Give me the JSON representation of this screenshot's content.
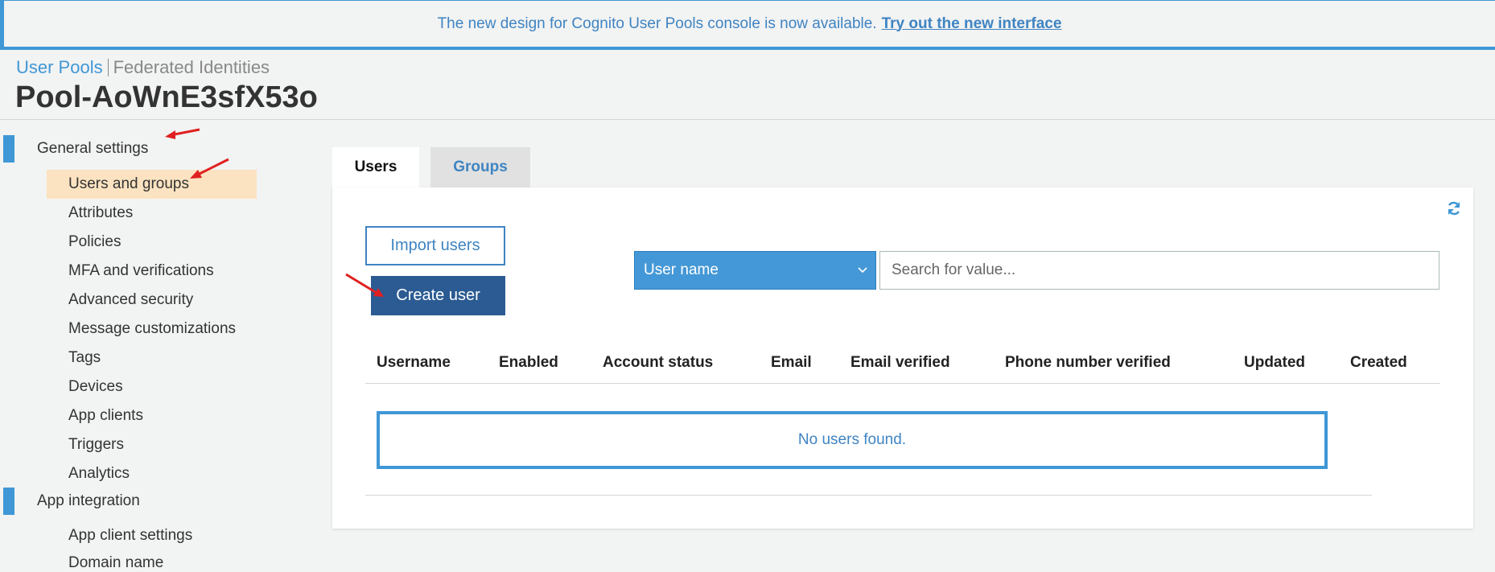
{
  "banner": {
    "text": "The new design for Cognito User Pools console is now available.",
    "link": "Try out the new interface"
  },
  "header": {
    "crumb_active": "User Pools",
    "crumb_inactive": "Federated Identities",
    "title": "Pool-AoWnE3sfX53o"
  },
  "sidebar": {
    "sections": [
      {
        "label": "General settings"
      },
      {
        "label": "App integration"
      }
    ],
    "items": [
      {
        "label": "Users and groups"
      },
      {
        "label": "Attributes"
      },
      {
        "label": "Policies"
      },
      {
        "label": "MFA and verifications"
      },
      {
        "label": "Advanced security"
      },
      {
        "label": "Message customizations"
      },
      {
        "label": "Tags"
      },
      {
        "label": "Devices"
      },
      {
        "label": "App clients"
      },
      {
        "label": "Triggers"
      },
      {
        "label": "Analytics"
      },
      {
        "label": "App client settings"
      },
      {
        "label": "Domain name"
      }
    ]
  },
  "tabs": [
    {
      "label": "Users"
    },
    {
      "label": "Groups"
    }
  ],
  "actions": {
    "import": "Import users",
    "create": "Create user"
  },
  "filter": {
    "selected": "User name",
    "placeholder": "Search for value..."
  },
  "table": {
    "columns": [
      "Username",
      "Enabled",
      "Account status",
      "Email",
      "Email verified",
      "Phone number verified",
      "Updated",
      "Created"
    ],
    "empty_message": "No users found."
  },
  "colors": {
    "accent": "#3f97d6",
    "primary_button": "#2b5b92",
    "selected_nav": "#fbe3c1",
    "annotation_arrow": "#e02020"
  }
}
